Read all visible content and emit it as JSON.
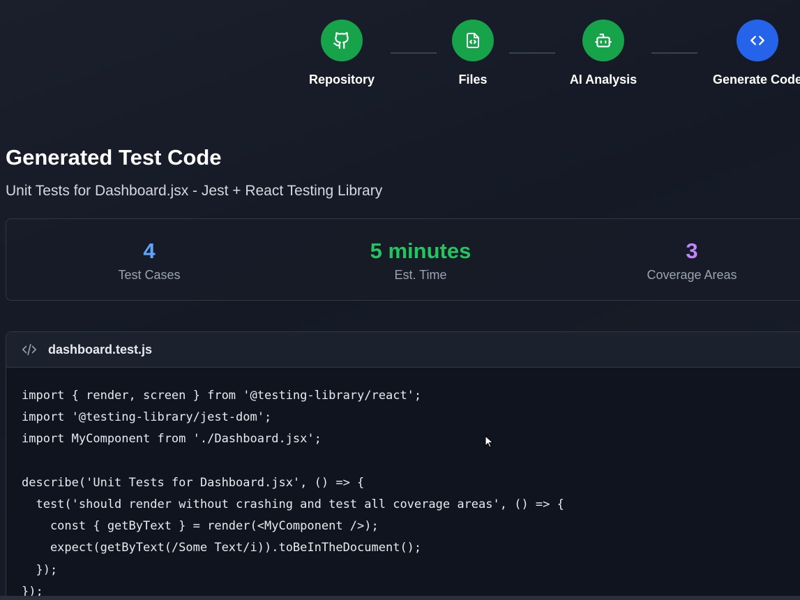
{
  "stepper": {
    "steps": [
      {
        "label": "Repository",
        "icon": "github-icon",
        "state": "done"
      },
      {
        "label": "Files",
        "icon": "file-code-icon",
        "state": "done"
      },
      {
        "label": "AI Analysis",
        "icon": "bot-icon",
        "state": "done"
      },
      {
        "label": "Generate Code",
        "icon": "code-icon",
        "state": "active"
      }
    ]
  },
  "heading": {
    "title": "Generated Test Code",
    "subtitle": "Unit Tests for Dashboard.jsx - Jest + React Testing Library"
  },
  "stats": [
    {
      "value": "4",
      "label": "Test Cases",
      "color": "#60a5fa"
    },
    {
      "value": "5 minutes",
      "label": "Est. Time",
      "color": "#22c55e"
    },
    {
      "value": "3",
      "label": "Coverage Areas",
      "color": "#c084fc"
    }
  ],
  "code": {
    "filename": "dashboard.test.js",
    "lines": [
      "import { render, screen } from '@testing-library/react';",
      "import '@testing-library/jest-dom';",
      "import MyComponent from './Dashboard.jsx';",
      "",
      "describe('Unit Tests for Dashboard.jsx', () => {",
      "  test('should render without crashing and test all coverage areas', () => {",
      "    const { getByText } = render(<MyComponent />);",
      "    expect(getByText(/Some Text/i)).toBeInTheDocument();",
      "  });",
      "});"
    ]
  },
  "colors": {
    "step_done": "#16a34a",
    "step_active": "#2563eb",
    "background": "#161b26"
  }
}
